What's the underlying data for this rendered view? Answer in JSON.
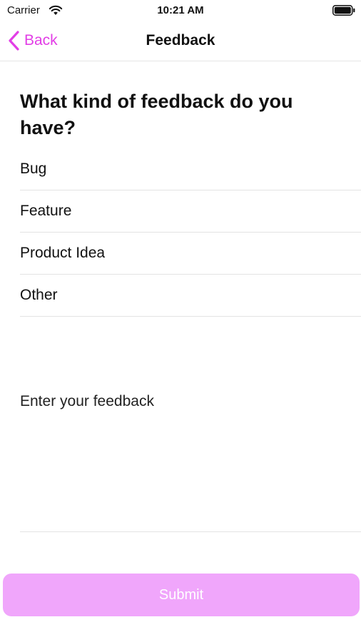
{
  "status_bar": {
    "carrier": "Carrier",
    "time": "10:21 AM",
    "wifi_icon": "wifi-icon",
    "battery_icon": "battery-icon"
  },
  "nav": {
    "back_label": "Back",
    "back_icon": "chevron-left-icon",
    "title": "Feedback",
    "accent_color": "#e23ee6"
  },
  "form": {
    "question": "What kind of feedback do you have?",
    "options": [
      {
        "label": "Bug"
      },
      {
        "label": "Feature"
      },
      {
        "label": "Product Idea"
      },
      {
        "label": "Other"
      }
    ],
    "feedback_placeholder": "Enter your feedback",
    "feedback_value": ""
  },
  "submit": {
    "label": "Submit",
    "background_color": "#f0a6fb",
    "text_color": "#ffffff"
  }
}
